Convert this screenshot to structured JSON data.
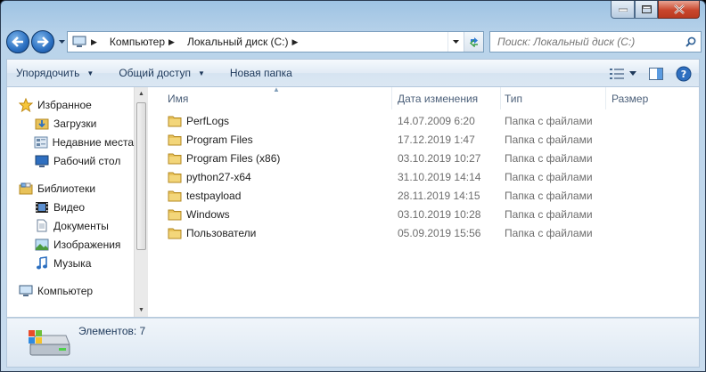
{
  "window": {
    "minimize_label": "",
    "maximize_label": "",
    "close_label": ""
  },
  "address": {
    "crumbs": [
      "Компьютер",
      "Локальный диск (C:)"
    ]
  },
  "search": {
    "placeholder": "Поиск: Локальный диск (C:)"
  },
  "toolbar": {
    "organize": "Упорядочить",
    "share": "Общий доступ",
    "new_folder": "Новая папка"
  },
  "nav": {
    "favorites": {
      "title": "Избранное",
      "items": [
        "Загрузки",
        "Недавние места",
        "Рабочий стол"
      ]
    },
    "libraries": {
      "title": "Библиотеки",
      "items": [
        "Видео",
        "Документы",
        "Изображения",
        "Музыка"
      ]
    },
    "computer": {
      "title": "Компьютер"
    }
  },
  "columns": {
    "name": "Имя",
    "date": "Дата изменения",
    "type": "Тип",
    "size": "Размер"
  },
  "files": [
    {
      "name": "PerfLogs",
      "date": "14.07.2009 6:20",
      "type": "Папка с файлами"
    },
    {
      "name": "Program Files",
      "date": "17.12.2019 1:47",
      "type": "Папка с файлами"
    },
    {
      "name": "Program Files (x86)",
      "date": "03.10.2019 10:27",
      "type": "Папка с файлами"
    },
    {
      "name": "python27-x64",
      "date": "31.10.2019 14:14",
      "type": "Папка с файлами"
    },
    {
      "name": "testpayload",
      "date": "28.11.2019 14:15",
      "type": "Папка с файлами"
    },
    {
      "name": "Windows",
      "date": "03.10.2019 10:28",
      "type": "Папка с файлами"
    },
    {
      "name": "Пользователи",
      "date": "05.09.2019 15:56",
      "type": "Папка с файлами"
    }
  ],
  "status": {
    "count": "Элементов: 7"
  },
  "colors": {
    "folder": "#e8c25a",
    "accent": "#1e395b"
  }
}
